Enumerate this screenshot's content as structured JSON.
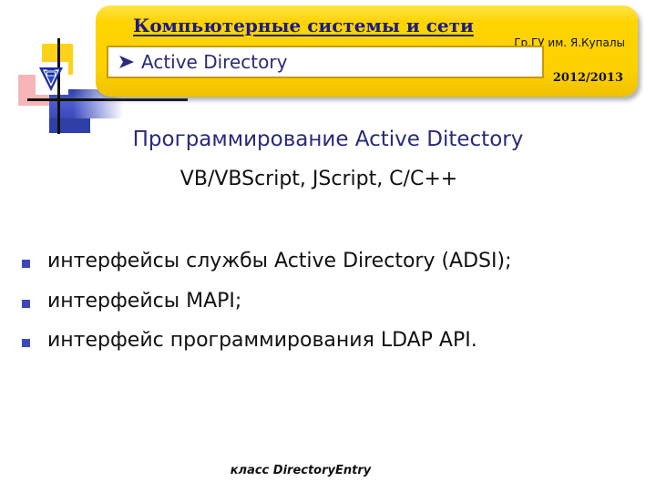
{
  "banner": {
    "course_title": "Компьютерные системы и сети",
    "organization": "Гр.ГУ им. Я.Купалы",
    "academic_year": "2012/2013",
    "topic_bullet_icon": "arrow-bullet-icon",
    "topic": "Active Directory"
  },
  "logo": {
    "name": "university-logo",
    "emblem_icon": "triangle-emblem-icon"
  },
  "slide": {
    "heading": "Программирование Active Ditectory",
    "subheading": "VB/VBScript, JScript, C/C++",
    "bullets": [
      "интерфейсы службы Active Directory (ADSI);",
      "интерфейсы MAPI;",
      "интерфейс программирования LDAP API."
    ],
    "footnote": "класс DirectoryEntry"
  },
  "colors": {
    "banner_yellow": "#FFD400",
    "title_navy": "#1A1A8C",
    "heading_blue": "#2A2A7A",
    "bullet_blue": "#3B49B8",
    "subbar_border": "#C79A06",
    "logo_pink": "#F7B5B8"
  }
}
